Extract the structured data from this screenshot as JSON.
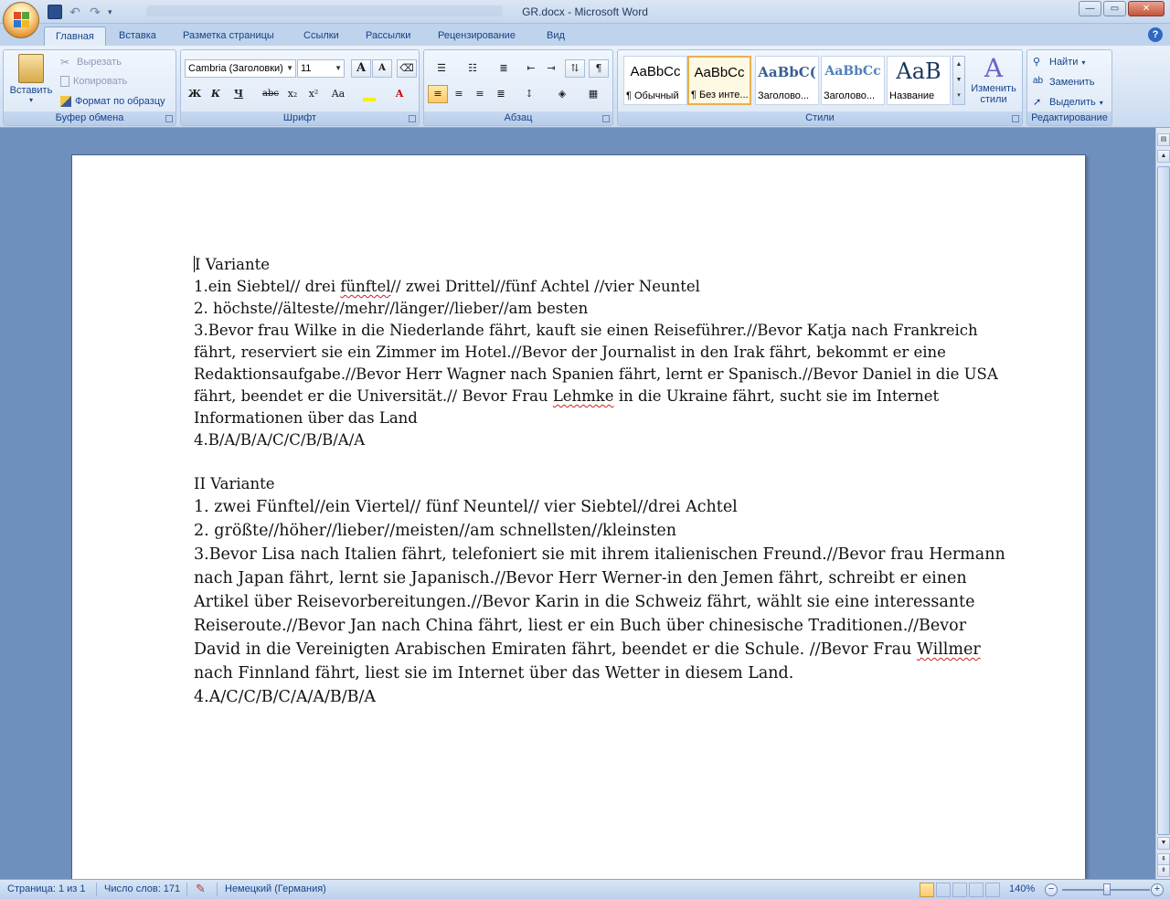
{
  "window": {
    "title": "GR.docx - Microsoft Word",
    "buttons": {
      "minimize": "—",
      "maximize": "▭",
      "close": "✕"
    }
  },
  "tabs": [
    "Главная",
    "Вставка",
    "Разметка страницы",
    "Ссылки",
    "Рассылки",
    "Рецензирование",
    "Вид"
  ],
  "ribbon": {
    "clipboard": {
      "paste": "Вставить",
      "cut": "Вырезать",
      "copy": "Копировать",
      "format_painter": "Формат по образцу",
      "label": "Буфер обмена"
    },
    "font": {
      "font_name": "Cambria (Заголовки)",
      "font_size": "11",
      "label": "Шрифт",
      "bold": "Ж",
      "italic": "К",
      "underline": "Ч",
      "strike": "abc",
      "subscript": "x₂",
      "superscript": "x²",
      "change_case": "Aa",
      "grow": "A",
      "shrink": "A"
    },
    "paragraph": {
      "label": "Абзац",
      "pilcrow": "¶"
    },
    "styles": {
      "label": "Стили",
      "items": [
        {
          "sample": "AaBbCc",
          "name": "¶ Обычный"
        },
        {
          "sample": "AaBbCc",
          "name": "¶ Без инте..."
        },
        {
          "sample": "AaBbC(",
          "name": "Заголово..."
        },
        {
          "sample": "AaBbCc",
          "name": "Заголово..."
        },
        {
          "sample": "AaB",
          "name": "Название"
        }
      ],
      "change_styles": "Изменить стили"
    },
    "editing": {
      "label": "Редактирование",
      "find": "Найти",
      "replace": "Заменить",
      "select": "Выделить"
    }
  },
  "document": {
    "variant1": {
      "heading": "I Variante",
      "line1_before": "1.ein Siebtel// drei ",
      "line1_word": "fünftel",
      "line1_after": "// zwei Drittel//fünf Achtel //vier Neuntel",
      "line2": "2. höchste//älteste//mehr//länger//lieber//am  besten",
      "line3_before": "3.Bevor frau Wilke in die Niederlande fährt, kauft sie einen Reiseführer.//Bevor Katja nach Frankreich fährt, reserviert sie ein Zimmer im Hotel.//Bevor der Journalist in den Irak fährt, bekommt er eine Redaktionsaufgabe.//Bevor Herr Wagner nach Spanien fährt, lernt er Spanisch.//Bevor Daniel in die USA fährt, beendet er die Universität.// Bevor Frau ",
      "line3_word": "Lehmke",
      "line3_after": " in die Ukraine fährt, sucht sie im Internet Informationen über das Land",
      "line4": "4.B/A/B/A/C/C/B/B/A/A"
    },
    "variant2": {
      "heading": "II  Variante",
      "line1": "1. zwei Fünftel//ein Viertel// fünf Neuntel// vier Siebtel//drei Achtel",
      "line2": "2. größte//höher//lieber//meisten//am  schnellsten//kleinsten",
      "line3_before": "3.Bevor Lisa nach Italien fährt, telefoniert sie mit ihrem italienischen Freund.//Bevor frau Hermann nach Japan fährt, lernt sie Japanisch.//Bevor Herr Werner-in den Jemen fährt, schreibt er einen Artikel über Reisevorbereitungen.//Bevor Karin in die Schweiz fährt, wählt sie eine interessante Reiseroute.//Bevor Jan nach China fährt, liest er ein Buch über chinesische Traditionen.//Bevor David in die Vereinigten Arabischen Emiraten fährt, beendet er die Schule.  //Bevor Frau ",
      "line3_word": "Willmer",
      "line3_after": " nach Finnland fährt, liest sie im Internet über das Wetter in diesem Land.",
      "line4": "4.A/C/C/B/C/A/A/B/B/A"
    }
  },
  "status": {
    "page": "Страница: 1 из 1",
    "words": "Число слов: 171",
    "language": "Немецкий (Германия)",
    "zoom": "140%"
  }
}
